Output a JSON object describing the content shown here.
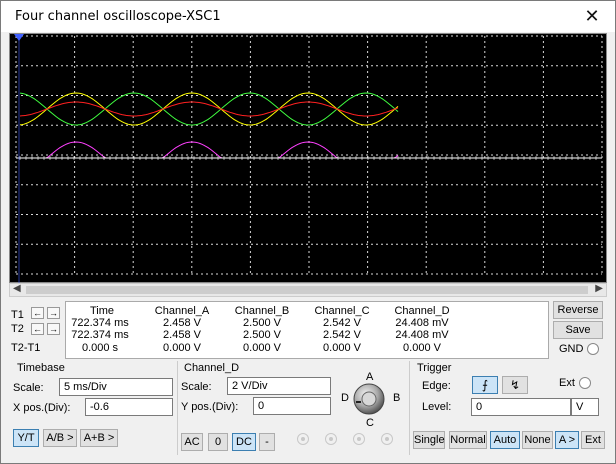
{
  "window": {
    "title": "Four channel oscilloscope-XSC1",
    "close_glyph": "✕"
  },
  "scope": {
    "background": "#000000",
    "grid_color": "#d8d8d8",
    "trace_colors": {
      "channel_a": "#ffff00",
      "channel_b": "#ff2020",
      "channel_c": "#40ff40",
      "channel_d": "#ff40ff",
      "baseline": "#ffffff"
    },
    "marker_t1_color": "#4060ff"
  },
  "readout": {
    "rows": [
      "T1",
      "T2",
      "T2-T1"
    ],
    "headers": [
      "Time",
      "Channel_A",
      "Channel_B",
      "Channel_C",
      "Channel_D"
    ],
    "data": [
      [
        "722.374 ms",
        "2.458 V",
        "2.500 V",
        "2.542 V",
        "24.408 mV"
      ],
      [
        "722.374 ms",
        "2.458 V",
        "2.500 V",
        "2.542 V",
        "24.408 mV"
      ],
      [
        "0.000 s",
        "0.000 V",
        "0.000 V",
        "0.000 V",
        "0.000 V"
      ]
    ],
    "reverse_label": "Reverse",
    "save_label": "Save",
    "gnd_label": "GND"
  },
  "timebase": {
    "title": "Timebase",
    "scale_label": "Scale:",
    "scale_value": "5 ms/Div",
    "xpos_label": "X pos.(Div):",
    "xpos_value": "-0.6",
    "modes": [
      "Y/T",
      "A/B >",
      "A+B >"
    ]
  },
  "channel": {
    "title": "Channel_D",
    "scale_label": "Scale:",
    "scale_value": "2  V/Div",
    "ypos_label": "Y pos.(Div):",
    "ypos_value": "0",
    "couplings": [
      "AC",
      "0",
      "DC",
      "-"
    ],
    "knob_labels": {
      "a": "A",
      "b": "B",
      "c": "C",
      "d": "D"
    }
  },
  "trigger": {
    "title": "Trigger",
    "edge_label": "Edge:",
    "ext_label": "Ext",
    "level_label": "Level:",
    "level_value": "0",
    "level_unit": "V",
    "modes": [
      "Single",
      "Normal",
      "Auto",
      "None",
      "A >",
      "Ext"
    ]
  }
}
